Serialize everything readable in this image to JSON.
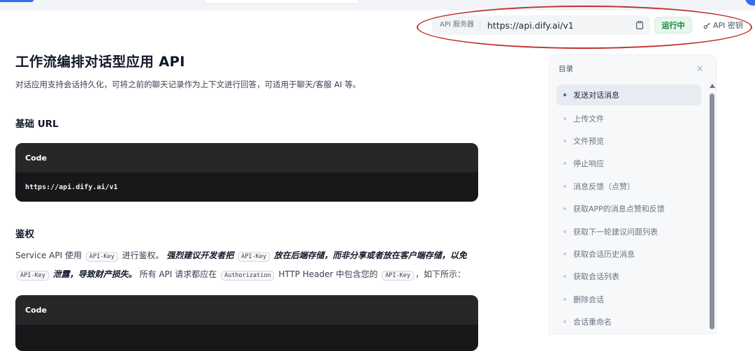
{
  "header": {
    "api_server_label": "API 服务器",
    "api_url": "https://api.dify.ai/v1",
    "status": "运行中",
    "api_key_label": "API 密钥"
  },
  "main": {
    "title": "工作流编排对话型应用 API",
    "subtitle": "对话应用支持会话持久化，可将之前的聊天记录作为上下文进行回答，可适用于聊天/客服 AI 等。",
    "base_url_heading": "基础 URL",
    "code1": {
      "label": "Code",
      "content": "https://api.dify.ai/v1"
    },
    "auth_heading": "鉴权",
    "auth_paragraph": {
      "p1": "Service API 使用",
      "code_apikey": "API-Key",
      "p2": "进行鉴权。",
      "bold1": "强烈建议开发者把",
      "bold2": "放在后端存储，而非分享或者放在客户端存储，以免",
      "bold3": "泄露，导致财产损失。",
      "p3": "所有 API 请求都应在",
      "code_auth": "Authorization",
      "p4": "HTTP Header 中包含您的",
      "p5": "，如下所示："
    },
    "code2": {
      "label": "Code"
    }
  },
  "toc": {
    "title": "目录",
    "close": "×",
    "items": [
      "发送对话消息",
      "上传文件",
      "文件预览",
      "停止响应",
      "消息反馈（点赞）",
      "获取APP的消息点赞和反馈",
      "获取下一轮建议问题列表",
      "获取会话历史消息",
      "获取会话列表",
      "删除会话",
      "会话重命名"
    ]
  },
  "colors": {
    "accent": "#2563eb",
    "status_green": "#16803c",
    "code_bg": "#18181b",
    "annotation": "#c0302b"
  },
  "icons": [
    "clipboard-icon",
    "key-icon",
    "close-icon",
    "scroll-up-arrow-icon"
  ]
}
